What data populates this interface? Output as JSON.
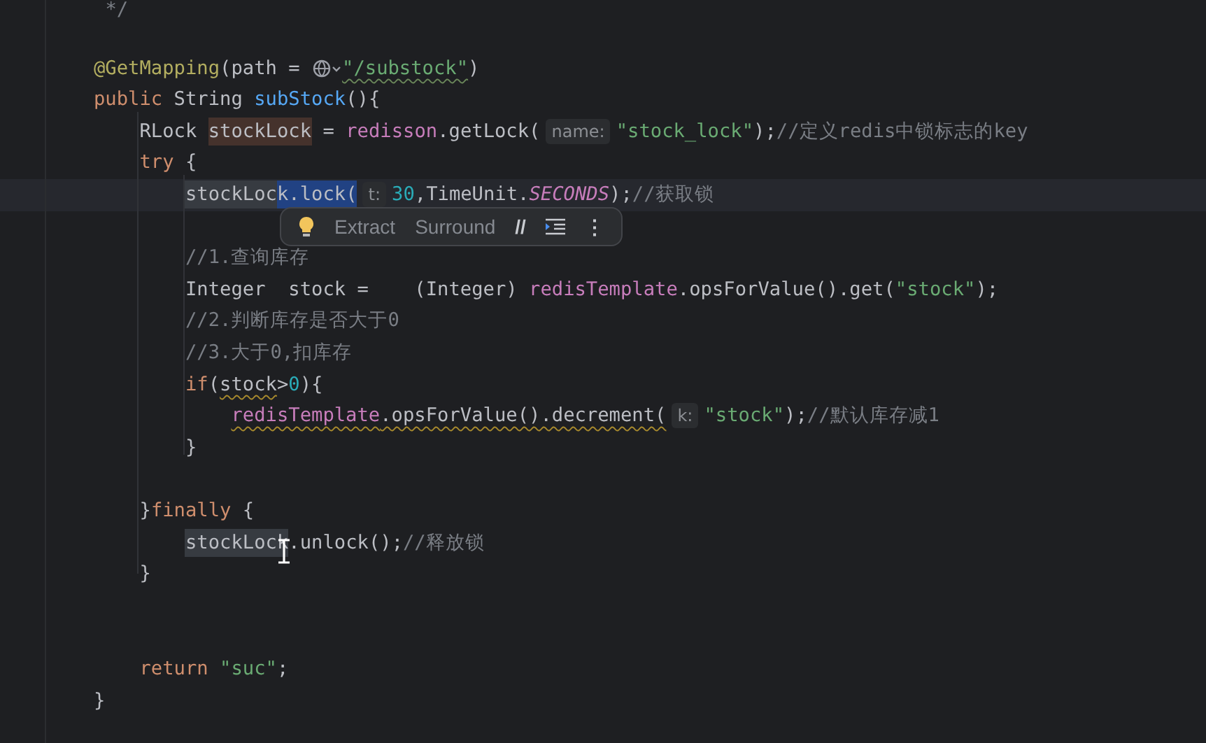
{
  "editor": {
    "lines": [
      {
        "tokens": [
          {
            "text": " */",
            "kind": "comment"
          }
        ]
      },
      {
        "blank_before": true,
        "tokens": [
          {
            "text": "@GetMapping",
            "kind": "annotation"
          },
          {
            "text": "(path = ",
            "kind": "text"
          },
          {
            "kind": "globe"
          },
          {
            "text": "\"/substock\"",
            "kind": "string",
            "typo_underline": true
          },
          {
            "text": ")",
            "kind": "text"
          }
        ]
      },
      {
        "tokens": [
          {
            "text": "public ",
            "kind": "keyword"
          },
          {
            "text": "String ",
            "kind": "text"
          },
          {
            "text": "subStock",
            "kind": "method"
          },
          {
            "text": "(){",
            "kind": "text"
          }
        ]
      },
      {
        "tokens": [
          {
            "text": "    RLock ",
            "kind": "text"
          },
          {
            "text": "stockLock",
            "kind": "text",
            "write_usage": true
          },
          {
            "text": " = ",
            "kind": "text"
          },
          {
            "text": "redisson",
            "kind": "field"
          },
          {
            "text": ".getLock(",
            "kind": "text"
          },
          {
            "text": "name:",
            "kind": "hint"
          },
          {
            "text": "\"stock_lock\"",
            "kind": "string"
          },
          {
            "text": ");",
            "kind": "text"
          },
          {
            "text": "//定义redis中锁标志的key",
            "kind": "comment"
          }
        ]
      },
      {
        "tokens": [
          {
            "text": "    try ",
            "kind": "keyword"
          },
          {
            "text": "{",
            "kind": "text"
          }
        ]
      },
      {
        "current": true,
        "tokens": [
          {
            "text": "        stockLoc",
            "kind": "text",
            "read_usage": true
          },
          {
            "text": "k.lock(",
            "kind": "text",
            "selected": true
          },
          {
            "text": "t:",
            "kind": "hint"
          },
          {
            "text": "30",
            "kind": "number"
          },
          {
            "text": ",TimeUnit.",
            "kind": "text"
          },
          {
            "text": "SECONDS",
            "kind": "constant"
          },
          {
            "text": ");",
            "kind": "text"
          },
          {
            "text": "//获取锁",
            "kind": "comment"
          }
        ]
      },
      {
        "blank_before": true,
        "tokens": [
          {
            "text": "        //1.查询库存",
            "kind": "comment"
          }
        ]
      },
      {
        "tokens": [
          {
            "text": "        Integer  stock =    (Integer) ",
            "kind": "text"
          },
          {
            "text": "redisTemplate",
            "kind": "field"
          },
          {
            "text": ".opsForValue().get(",
            "kind": "text"
          },
          {
            "text": "\"stock\"",
            "kind": "string"
          },
          {
            "text": ");",
            "kind": "text"
          }
        ]
      },
      {
        "tokens": [
          {
            "text": "        //2.判断库存是否大于0",
            "kind": "comment"
          }
        ]
      },
      {
        "tokens": [
          {
            "text": "        //3.大于0,扣库存",
            "kind": "comment"
          }
        ]
      },
      {
        "tokens": [
          {
            "text": "        if",
            "kind": "keyword"
          },
          {
            "text": "(",
            "kind": "text"
          },
          {
            "text": "stock",
            "kind": "text",
            "warning_underline": true
          },
          {
            "text": ">",
            "kind": "text"
          },
          {
            "text": "0",
            "kind": "number"
          },
          {
            "text": "){",
            "kind": "text"
          }
        ]
      },
      {
        "tokens": [
          {
            "text": "            redisTemplate",
            "kind": "field",
            "warning_underline": true
          },
          {
            "text": ".opsForValue().decrement(",
            "kind": "text",
            "warning_underline": true
          },
          {
            "text": "k:",
            "kind": "hint"
          },
          {
            "text": "\"stock\"",
            "kind": "string"
          },
          {
            "text": ");",
            "kind": "text"
          },
          {
            "text": "//默认库存减1",
            "kind": "comment"
          }
        ]
      },
      {
        "tokens": [
          {
            "text": "        }",
            "kind": "text"
          }
        ]
      },
      {
        "blank_before": true,
        "tokens": [
          {
            "text": "    }",
            "kind": "text"
          },
          {
            "text": "finally ",
            "kind": "keyword"
          },
          {
            "text": "{",
            "kind": "text"
          }
        ]
      },
      {
        "tokens": [
          {
            "text": "        stockLock",
            "kind": "text",
            "read_usage": true
          },
          {
            "text": ".unlock();",
            "kind": "text"
          },
          {
            "text": "//释放锁",
            "kind": "comment"
          }
        ]
      },
      {
        "blank_after": true,
        "tokens": [
          {
            "text": "    }",
            "kind": "text"
          }
        ]
      },
      {
        "blank_before": true,
        "tokens": [
          {
            "text": "    return ",
            "kind": "keyword"
          },
          {
            "text": "\"suc\"",
            "kind": "string"
          },
          {
            "text": ";",
            "kind": "text"
          }
        ]
      },
      {
        "tokens": [
          {
            "text": "}",
            "kind": "text"
          }
        ]
      }
    ]
  },
  "intention_popup": {
    "items": [
      {
        "kind": "bulb"
      },
      {
        "kind": "label",
        "text": "Extract"
      },
      {
        "kind": "label",
        "text": "Surround"
      },
      {
        "kind": "glyph",
        "text": "//"
      },
      {
        "kind": "indent"
      },
      {
        "kind": "glyph",
        "text": "⋮"
      }
    ]
  }
}
